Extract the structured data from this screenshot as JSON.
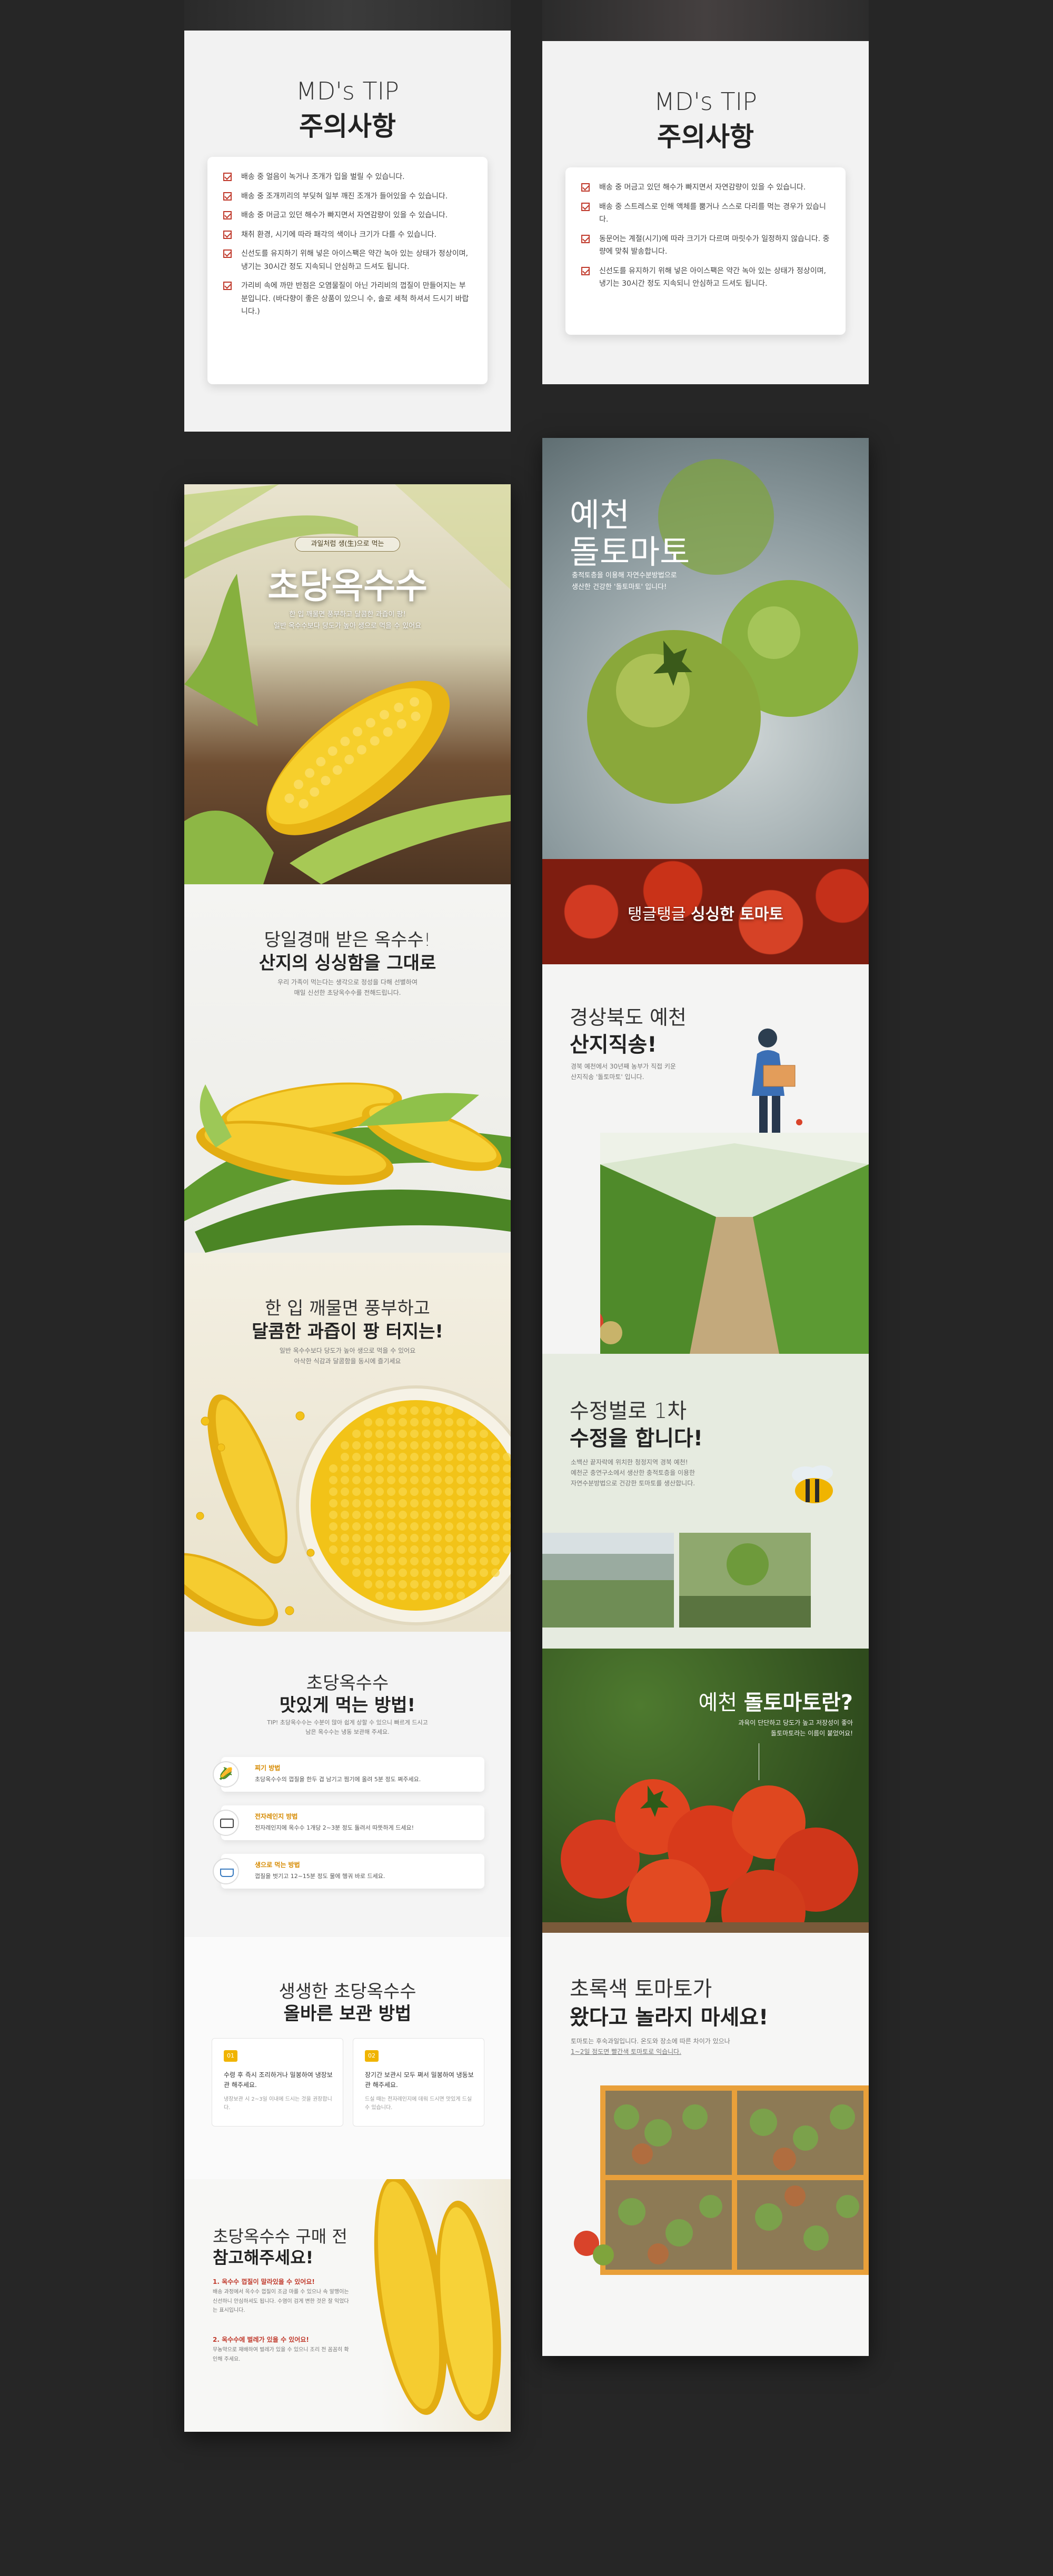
{
  "tips": {
    "left": {
      "eyebrow": "MD's TIP",
      "title": "주의사항",
      "items": [
        "배송 중 얼음이 녹거나 조개가 입을 벌릴 수 있습니다.",
        "배송 중 조개끼리의 부딪혀 일부 깨진 조개가 들어있을 수 있습니다.",
        "배송 중 머금고 있던 해수가 빠지면서 자연감량이 있을 수 있습니다.",
        "채취 환경, 시기에 따라 패각의 색이나 크기가 다를 수 있습니다.",
        "신선도를 유지하기 위해 넣은 아이스팩은 약간 녹아 있는 상태가 정상이며, 냉기는 30시간 정도 지속되니 안심하고 드셔도 됩니다.",
        "가리비 속에 까만 반점은 오염물질이 아닌 가리비의 껍질이 만들어지는 부분입니다. (바다향이 좋은 상품이 있으니 수, 솔로 세척 하셔서 드시기 바랍니다.)"
      ]
    },
    "right": {
      "eyebrow": "MD's TIP",
      "title": "주의사항",
      "items": [
        "배송 중 머금고 있던 해수가 빠지면서 자연감량이 있을 수 있습니다.",
        "배송 중 스트레스로 인해 액체를 뿜거나 스스로 다리를 먹는 경우가 있습니다.",
        "동문어는 계절(시기)에 따라 크기가 다르며 마릿수가 일정하지 않습니다. 중량에 맞춰 발송합니다.",
        "신선도를 유지하기 위해 넣은 아이스팩은 약간 녹아 있는 상태가 정상이며, 냉기는 30시간 정도 지속되니 안심하고 드셔도 됩니다."
      ]
    }
  },
  "corn": {
    "hero": {
      "badge": "과일처럼 생(生)으로 먹는",
      "title": "초당옥수수",
      "desc1": "한 입 깨물면 풍부하고 달콤한 과즙이 팡!",
      "desc2": "일반 옥수수보다 당도가 높아 생으로 먹을 수 있어요"
    },
    "fresh": {
      "line1": "당일경매 받은 옥수수!",
      "line2": "산지의 싱싱함을 그대로",
      "desc1": "우리 가족이 먹는다는 생각으로 정성을 다해 선별하여",
      "desc2": "매일 신선한 초당옥수수를 전해드립니다."
    },
    "juicy": {
      "line1": "한 입 깨물면 풍부하고",
      "line2": "달콤한 과즙이 팡 터지는!",
      "desc1": "일반 옥수수보다 당도가 높아 생으로 먹을 수 있어요",
      "desc2": "아삭한 식감과 달콤함을 동시에 즐기세요"
    },
    "how": {
      "line1": "초당옥수수",
      "line2": "맛있게 먹는 방법!",
      "desc1": "TIP! 초당옥수수는 수분이 많아 쉽게 상할 수 있으니 빠르게 드시고",
      "desc2": "남은 옥수수는 냉동 보관해 주세요.",
      "methods": [
        {
          "label": "찌기 방법",
          "text": "초당옥수수의 껍질을 한두 겹 남기고 찜기에 올려 5분 정도 쪄주세요."
        },
        {
          "label": "전자레인지 방법",
          "text": "전자레인지에 옥수수 1개당 2~3분 정도 돌려서 따뜻하게 드세요!"
        },
        {
          "label": "생으로 먹는 방법",
          "text": "껍질을 벗기고 12~15분 정도 물에 헹궈 바로 드세요."
        }
      ]
    },
    "store": {
      "line1": "생생한 초당옥수수",
      "line2": "올바른 보관 방법",
      "boxes": [
        {
          "num": "01",
          "title": "수령 후 즉시 조리하거나 밀봉하여 냉장보관 해주세요.",
          "desc": "냉장보관 시 2~3일 이내에 드시는 것을 권장합니다."
        },
        {
          "num": "02",
          "title": "장기간 보관시 모두 쪄서 밀봉하여 냉동보관 해주세요.",
          "desc": "드실 때는 전자레인지에 데워 드시면 맛있게 드실 수 있습니다."
        }
      ]
    },
    "before": {
      "line1": "초당옥수수 구매 전",
      "line2": "참고해주세요!",
      "n1title": "1. 옥수수 껍질이 말라있을 수 있어요!",
      "n1desc": "배송 과정에서 옥수수 껍질이 조금 마를 수 있으나 속 알맹이는 신선하니 안심하셔도 됩니다. 수염이 검게 변한 것은 잘 익었다는 표시입니다.",
      "n2title": "2. 옥수수에 벌레가 있을 수 있어요!",
      "n2desc": "무농약으로 재배하여 벌레가 있을 수 있으니 조리 전 꼼꼼히 확인해 주세요."
    }
  },
  "tomato": {
    "hero": {
      "line1": "예천",
      "line2": "돌토마토",
      "desc1": "충적토층을 이용해 자연수분방법으로",
      "desc2": "생산한 건강한 '돌토마토' 입니다!"
    },
    "banner": {
      "pre": "탱글탱글 ",
      "strong": "싱싱한 토마토"
    },
    "farm": {
      "line1": "경상북도 예천",
      "line2": "산지직송!",
      "desc1": "경북 예천에서 30년째 농부가 직접 키운",
      "desc2": "산지직송 '돌토마토' 입니다."
    },
    "bee": {
      "line1": "수정벌로 1차",
      "line2": "수정을 합니다!",
      "desc1": "소백산 끝자락에 위치한 청정지역 경북 예천!",
      "desc2": "예천군 충연구소에서 생산한 충적토층을 이용한",
      "desc3": "자연수분방법으로 건강한 토마토를 생산합니다."
    },
    "what": {
      "pre": "예천 ",
      "strong": "돌토마토란?",
      "desc1": "과육이 단단하고 당도가 높고 저장성이 좋아",
      "desc2": "돌토마토라는 이름이 붙었어요!"
    },
    "green": {
      "line1": "초록색 토마토가",
      "line2": "왔다고 놀라지 마세요!",
      "desc1": "토마토는 후숙과일입니다. 온도와 장소에 따른 차이가 있으나",
      "desc2": "1~2일 정도면 빨간색 토마토로 익습니다."
    }
  },
  "colors": {
    "background": "#262626",
    "accent_red": "#c0392b",
    "corn_yellow": "#f2c318",
    "tomato_green": "#6f9a3a"
  }
}
